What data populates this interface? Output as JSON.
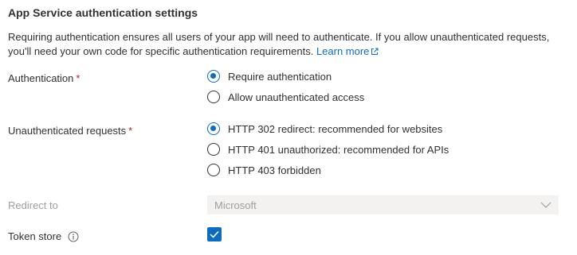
{
  "section": {
    "title": "App Service authentication settings",
    "description": "Requiring authentication ensures all users of your app will need to authenticate. If you allow unauthenticated requests, you'll need your own code for specific authentication requirements.",
    "learn_more": "Learn more"
  },
  "authentication": {
    "label": "Authentication",
    "required_mark": "*",
    "options": [
      {
        "label": "Require authentication",
        "selected": true
      },
      {
        "label": "Allow unauthenticated access",
        "selected": false
      }
    ]
  },
  "unauthenticated_requests": {
    "label": "Unauthenticated requests",
    "required_mark": "*",
    "options": [
      {
        "label": "HTTP 302 redirect: recommended for websites",
        "selected": true
      },
      {
        "label": "HTTP 401 unauthorized: recommended for APIs",
        "selected": false
      },
      {
        "label": "HTTP 403 forbidden",
        "selected": false
      }
    ]
  },
  "redirect_to": {
    "label": "Redirect to",
    "value": "Microsoft",
    "disabled": true,
    "icon": "chevron-down-icon"
  },
  "token_store": {
    "label": "Token store",
    "checked": true,
    "icon": "info-icon"
  },
  "colors": {
    "accent": "#0f6cbd",
    "required": "#a4262c",
    "text": "#323130",
    "disabled_text": "#a19f9d",
    "disabled_bg": "#f3f2f1"
  }
}
